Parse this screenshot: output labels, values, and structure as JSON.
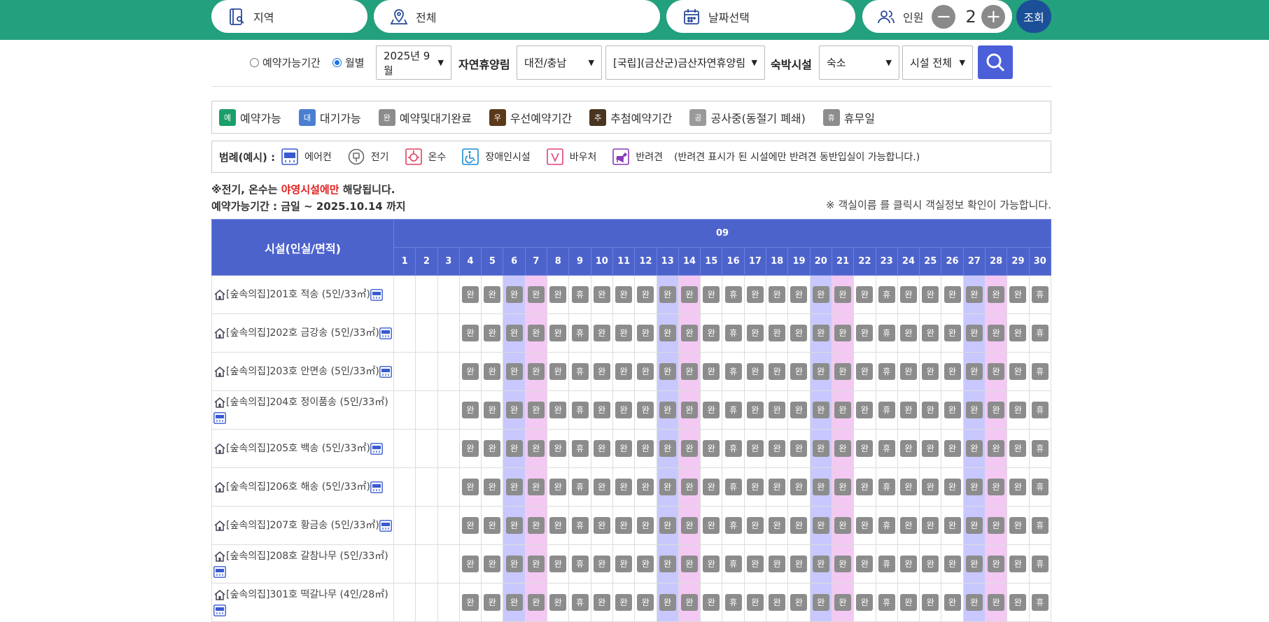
{
  "topbar": {
    "region_label": "지역",
    "all_label": "전체",
    "date_label": "날짜선택",
    "people_label": "인원",
    "people_count": "2",
    "minus": "−",
    "plus": "+",
    "inquiry_label": "조회"
  },
  "filters": {
    "radio_available": "예약가능기간",
    "radio_monthly": "월별",
    "month_select": "2025년 9월",
    "forest_label": "자연휴양림",
    "region_select": "대전/충남",
    "forest_select": "[국립](금산군)금산자연휴양림",
    "lodging_label": "숙박시설",
    "lodging_type_select": "숙소",
    "facility_select": "시설 전체"
  },
  "legend": [
    {
      "badge": "예",
      "label": "예약가능",
      "color": "#1a9e6a"
    },
    {
      "badge": "대",
      "label": "대기가능",
      "color": "#4a7fd0"
    },
    {
      "badge": "완",
      "label": "예약및대기완료",
      "color": "#8c8c8c"
    },
    {
      "badge": "우",
      "label": "우선예약기간",
      "color": "#5a3a1a"
    },
    {
      "badge": "추",
      "label": "추첨예약기간",
      "color": "#4a3520"
    },
    {
      "badge": "공",
      "label": "공사중(동절기 폐쇄)",
      "color": "#9a9a9a"
    },
    {
      "badge": "휴",
      "label": "휴무일",
      "color": "#8c8c8c"
    }
  ],
  "legend2": {
    "title": "범례(예시) :",
    "items": [
      {
        "icon": "air-conditioner-icon",
        "label": "에어컨"
      },
      {
        "icon": "electric-plug-icon",
        "label": "전기"
      },
      {
        "icon": "hot-water-icon",
        "label": "온수"
      },
      {
        "icon": "wheelchair-icon",
        "label": "장애인시설"
      },
      {
        "icon": "voucher-icon",
        "label": "바우처"
      },
      {
        "icon": "pet-dog-icon",
        "label": "반려견"
      }
    ],
    "pet_note": "(반려견 표시가 된 시설에만 반려견 동반입실이 가능합니다.)"
  },
  "notes": {
    "note1_prefix": "※전기, 온수는 ",
    "note1_highlight": "야영시설에만",
    "note1_suffix": " 해당됩니다.",
    "note2": "예약가능기간 : 금일 ~ 2025.10.14 까지",
    "note3": "※ 객실이름 를 클릭시 객실정보 확인이 가능합니다."
  },
  "calendar": {
    "facility_header": "시설(인실/면적)",
    "month_header": "09",
    "days": [
      "1",
      "2",
      "3",
      "4",
      "5",
      "6",
      "7",
      "8",
      "9",
      "10",
      "11",
      "12",
      "13",
      "14",
      "15",
      "16",
      "17",
      "18",
      "19",
      "20",
      "21",
      "22",
      "23",
      "24",
      "25",
      "26",
      "27",
      "28",
      "29",
      "30"
    ],
    "saturdays": [
      "6",
      "13",
      "20",
      "27"
    ],
    "sundays": [
      "7",
      "14",
      "21",
      "28"
    ],
    "rooms": [
      {
        "name": "[숲속의집]201호 적송 (5인/33㎡)",
        "status": [
          "",
          "",
          "",
          "완",
          "완",
          "완",
          "완",
          "완",
          "휴",
          "완",
          "완",
          "완",
          "완",
          "완",
          "완",
          "휴",
          "완",
          "완",
          "완",
          "완",
          "완",
          "완",
          "휴",
          "완",
          "완",
          "완",
          "완",
          "완",
          "완",
          "휴"
        ]
      },
      {
        "name": "[숲속의집]202호 금강송 (5인/33㎡)",
        "status": [
          "",
          "",
          "",
          "완",
          "완",
          "완",
          "완",
          "완",
          "휴",
          "완",
          "완",
          "완",
          "완",
          "완",
          "완",
          "휴",
          "완",
          "완",
          "완",
          "완",
          "완",
          "완",
          "휴",
          "완",
          "완",
          "완",
          "완",
          "완",
          "완",
          "휴"
        ]
      },
      {
        "name": "[숲속의집]203호 안면송 (5인/33㎡)",
        "status": [
          "",
          "",
          "",
          "완",
          "완",
          "완",
          "완",
          "완",
          "휴",
          "완",
          "완",
          "완",
          "완",
          "완",
          "완",
          "휴",
          "완",
          "완",
          "완",
          "완",
          "완",
          "완",
          "휴",
          "완",
          "완",
          "완",
          "완",
          "완",
          "완",
          "휴"
        ]
      },
      {
        "name": "[숲속의집]204호 정이품송 (5인/33㎡)",
        "status": [
          "",
          "",
          "",
          "완",
          "완",
          "완",
          "완",
          "완",
          "휴",
          "완",
          "완",
          "완",
          "완",
          "완",
          "완",
          "휴",
          "완",
          "완",
          "완",
          "완",
          "완",
          "완",
          "휴",
          "완",
          "완",
          "완",
          "완",
          "완",
          "완",
          "휴"
        ]
      },
      {
        "name": "[숲속의집]205호 백송 (5인/33㎡)",
        "status": [
          "",
          "",
          "",
          "완",
          "완",
          "완",
          "완",
          "완",
          "휴",
          "완",
          "완",
          "완",
          "완",
          "완",
          "완",
          "휴",
          "완",
          "완",
          "완",
          "완",
          "완",
          "완",
          "휴",
          "완",
          "완",
          "완",
          "완",
          "완",
          "완",
          "휴"
        ]
      },
      {
        "name": "[숲속의집]206호 해송 (5인/33㎡)",
        "status": [
          "",
          "",
          "",
          "완",
          "완",
          "완",
          "완",
          "완",
          "휴",
          "완",
          "완",
          "완",
          "완",
          "완",
          "완",
          "휴",
          "완",
          "완",
          "완",
          "완",
          "완",
          "완",
          "휴",
          "완",
          "완",
          "완",
          "완",
          "완",
          "완",
          "휴"
        ]
      },
      {
        "name": "[숲속의집]207호 황금송 (5인/33㎡)",
        "status": [
          "",
          "",
          "",
          "완",
          "완",
          "완",
          "완",
          "완",
          "휴",
          "완",
          "완",
          "완",
          "완",
          "완",
          "완",
          "휴",
          "완",
          "완",
          "완",
          "완",
          "완",
          "완",
          "휴",
          "완",
          "완",
          "완",
          "완",
          "완",
          "완",
          "휴"
        ]
      },
      {
        "name": "[숲속의집]208호 갈참나무 (5인/33㎡)",
        "status": [
          "",
          "",
          "",
          "완",
          "완",
          "완",
          "완",
          "완",
          "휴",
          "완",
          "완",
          "완",
          "완",
          "완",
          "완",
          "휴",
          "완",
          "완",
          "완",
          "완",
          "완",
          "완",
          "휴",
          "완",
          "완",
          "완",
          "완",
          "완",
          "완",
          "휴"
        ]
      },
      {
        "name": "[숲속의집]301호 떡갈나무 (4인/28㎡)",
        "status": [
          "",
          "",
          "",
          "완",
          "완",
          "완",
          "완",
          "완",
          "휴",
          "완",
          "완",
          "완",
          "완",
          "완",
          "완",
          "휴",
          "완",
          "완",
          "완",
          "완",
          "완",
          "완",
          "휴",
          "완",
          "완",
          "완",
          "완",
          "완",
          "완",
          "휴"
        ]
      }
    ]
  }
}
